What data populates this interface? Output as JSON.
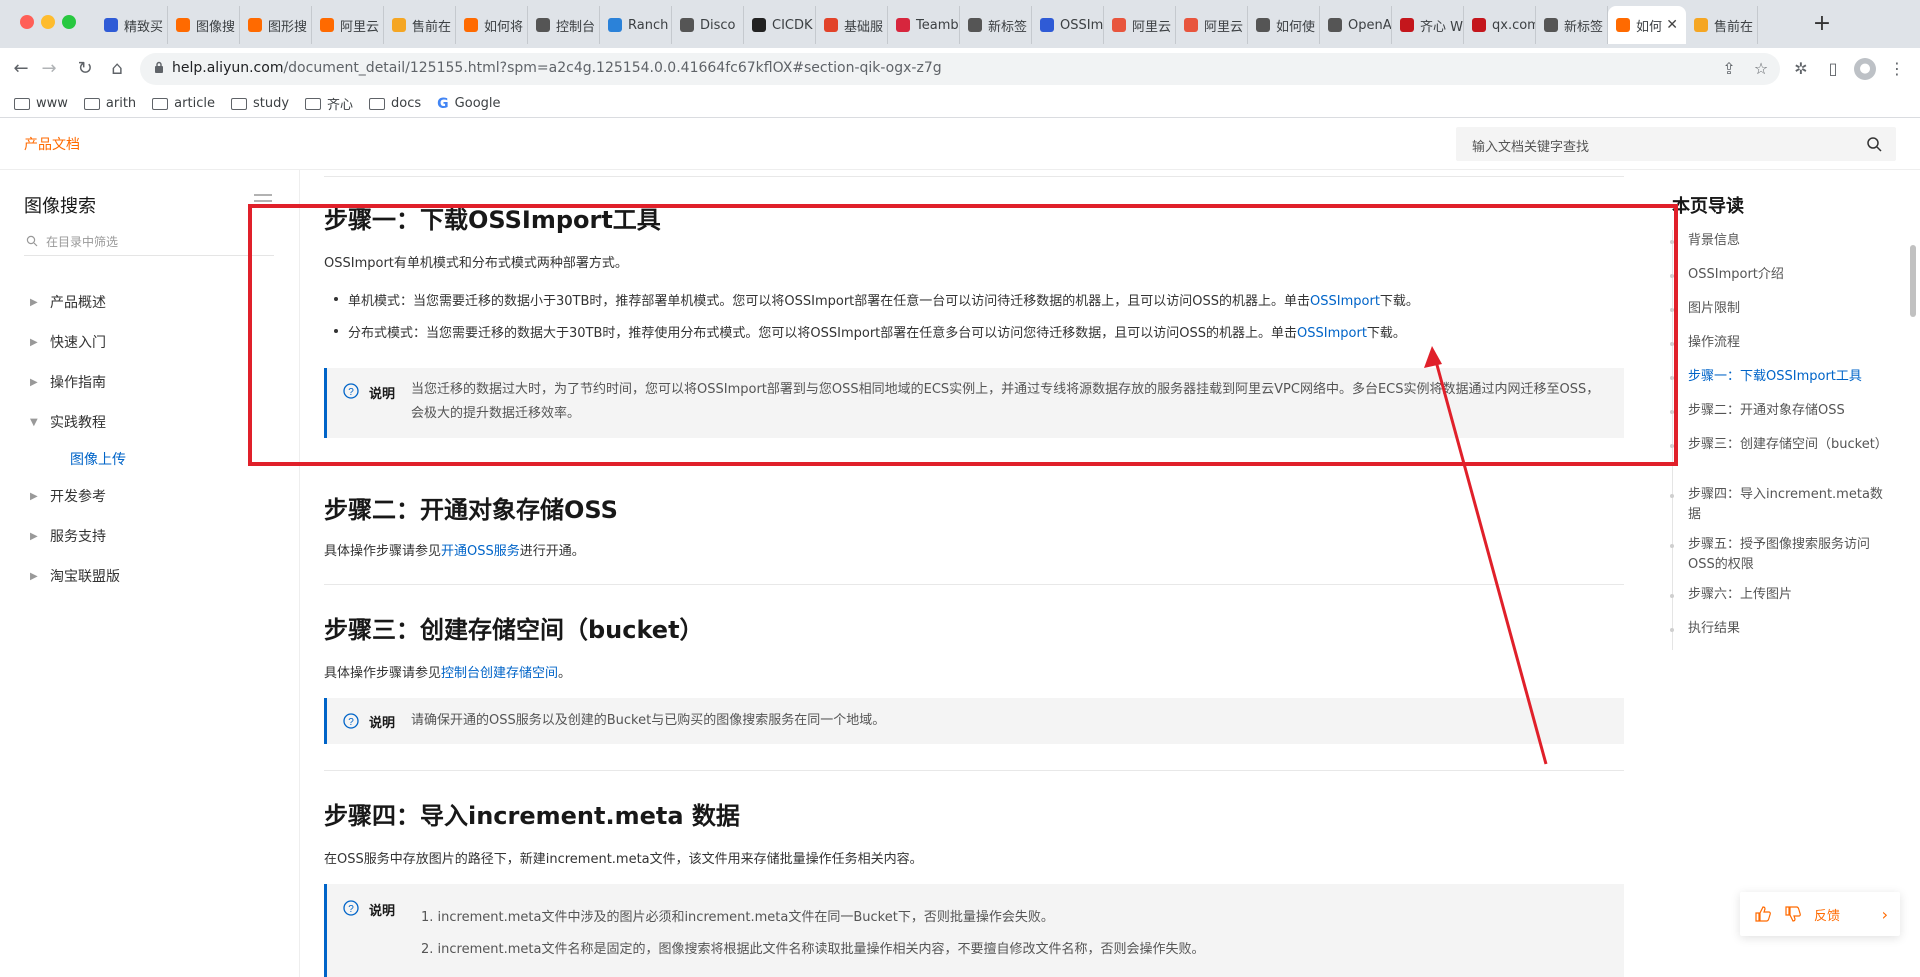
{
  "browser": {
    "tabs": [
      {
        "label": "精致买",
        "color": "#2f5bd6"
      },
      {
        "label": "图像搜",
        "color": "#ff6a00"
      },
      {
        "label": "图形搜",
        "color": "#ff6a00"
      },
      {
        "label": "阿里云",
        "color": "#ff6a00"
      },
      {
        "label": "售前在",
        "color": "#f5a623"
      },
      {
        "label": "如何将",
        "color": "#ff6a00"
      },
      {
        "label": "控制台",
        "color": "#555555"
      },
      {
        "label": "Ranch",
        "color": "#2b82d9"
      },
      {
        "label": "Disco",
        "color": "#555555"
      },
      {
        "label": "CICDK",
        "color": "#222222"
      },
      {
        "label": "基础服",
        "color": "#e24329"
      },
      {
        "label": "Teamb",
        "color": "#d7263d"
      },
      {
        "label": "新标签",
        "color": "#555555"
      },
      {
        "label": "OSSIm",
        "color": "#2f5bd6"
      },
      {
        "label": "阿里云",
        "color": "#e8553d"
      },
      {
        "label": "阿里云",
        "color": "#e8553d"
      },
      {
        "label": "如何使",
        "color": "#555555"
      },
      {
        "label": "OpenA",
        "color": "#555555"
      },
      {
        "label": "齐心 W",
        "color": "#c4161c"
      },
      {
        "label": "qx.com",
        "color": "#c4161c"
      },
      {
        "label": "新标签",
        "color": "#555555"
      },
      {
        "label": "如何",
        "color": "#ff6a00",
        "active": true
      },
      {
        "label": "售前在",
        "color": "#f5a623"
      }
    ],
    "tab_close": "✕",
    "new_tab": "+",
    "url_host": "help.aliyun.com",
    "url_path": "/document_detail/125155.html?spm=a2c4g.125154.0.0.41664fc67kflOX#section-qik-ogx-z7g",
    "bookmarks": [
      {
        "label": "www",
        "type": "folder"
      },
      {
        "label": "arith",
        "type": "folder"
      },
      {
        "label": "article",
        "type": "folder"
      },
      {
        "label": "study",
        "type": "folder"
      },
      {
        "label": "齐心",
        "type": "folder"
      },
      {
        "label": "docs",
        "type": "folder"
      },
      {
        "label": "Google",
        "type": "google"
      }
    ]
  },
  "header": {
    "brand": "产品文档",
    "search_placeholder": "输入文档关键字查找"
  },
  "sidebar": {
    "title": "图像搜索",
    "filter_placeholder": "在目录中筛选",
    "items": [
      {
        "label": "产品概述",
        "arrow": "▶"
      },
      {
        "label": "快速入门",
        "arrow": "▶"
      },
      {
        "label": "操作指南",
        "arrow": "▶"
      },
      {
        "label": "实践教程",
        "arrow": "▼"
      },
      {
        "label": "图像上传",
        "sub": true
      },
      {
        "label": "开发参考",
        "arrow": "▶"
      },
      {
        "label": "服务支持",
        "arrow": "▶"
      },
      {
        "label": "淘宝联盟版",
        "arrow": "▶"
      }
    ]
  },
  "content": {
    "step1_title": "步骤一：下载OSSImport工具",
    "step1_intro": "OSSImport有单机模式和分布式模式两种部署方式。",
    "step1_bullet1_pre": "单机模式：当您需要迁移的数据小于30TB时，推荐部署单机模式。您可以将OSSImport部署在任意一台可以访问待迁移数据的机器上，且可以访问OSS的机器上。单击",
    "step1_bullet1_link": "OSSImport",
    "step1_bullet1_post": "下载。",
    "step1_bullet2_pre": "分布式模式：当您需要迁移的数据大于30TB时，推荐使用分布式模式。您可以将OSSImport部署在任意多台可以访问您待迁移数据，且可以访问OSS的机器上。单击",
    "step1_bullet2_link": "OSSImport",
    "step1_bullet2_post": "下载。",
    "note_label": "说明",
    "step1_note": "当您迁移的数据过大时，为了节约时间，您可以将OSSImport部署到与您OSS相同地域的ECS实例上，并通过专线将源数据存放的服务器挂载到阿里云VPC网络中。多台ECS实例将数据通过内网迁移至OSS，会极大的提升数据迁移效率。",
    "step2_title": "步骤二：开通对象存储OSS",
    "step2_pre": "具体操作步骤请参见",
    "step2_link": "开通OSS服务",
    "step2_post": "进行开通。",
    "step3_title": "步骤三：创建存储空间（bucket）",
    "step3_pre": "具体操作步骤请参见",
    "step3_link": "控制台创建存储空间",
    "step3_post": "。",
    "step3_note": "请确保开通的OSS服务以及创建的Bucket与已购买的图像搜索服务在同一个地域。",
    "step4_title": "步骤四：导入increment.meta 数据",
    "step4_intro": "在OSS服务中存放图片的路径下，新建increment.meta文件，该文件用来存储批量操作任务相关内容。",
    "step4_note1": "1. increment.meta文件中涉及的图片必须和increment.meta文件在同一Bucket下，否则批量操作会失败。",
    "step4_note2": "2. increment.meta文件名称是固定的，图像搜索将根据此文件名称读取批量操作相关内容，不要擅自修改文件名称，否则会操作失败。"
  },
  "toc": {
    "title": "本页导读",
    "items": [
      {
        "label": "背景信息"
      },
      {
        "label": "OSSImport介绍"
      },
      {
        "label": "图片限制"
      },
      {
        "label": "操作流程"
      },
      {
        "label": "步骤一：下载OSSImport工具",
        "active": true
      },
      {
        "label": "步骤二：开通对象存储OSS"
      },
      {
        "label": "步骤三：创建存储空间（bucket）"
      },
      {
        "label": "步骤四：导入increment.meta数据"
      },
      {
        "label": "步骤五：授予图像搜索服务访问OSS的权限"
      },
      {
        "label": "步骤六：上传图片"
      },
      {
        "label": "执行结果"
      }
    ]
  },
  "feedback": {
    "label": "反馈",
    "chevron": "›"
  },
  "annotation_color": "#e0202a"
}
